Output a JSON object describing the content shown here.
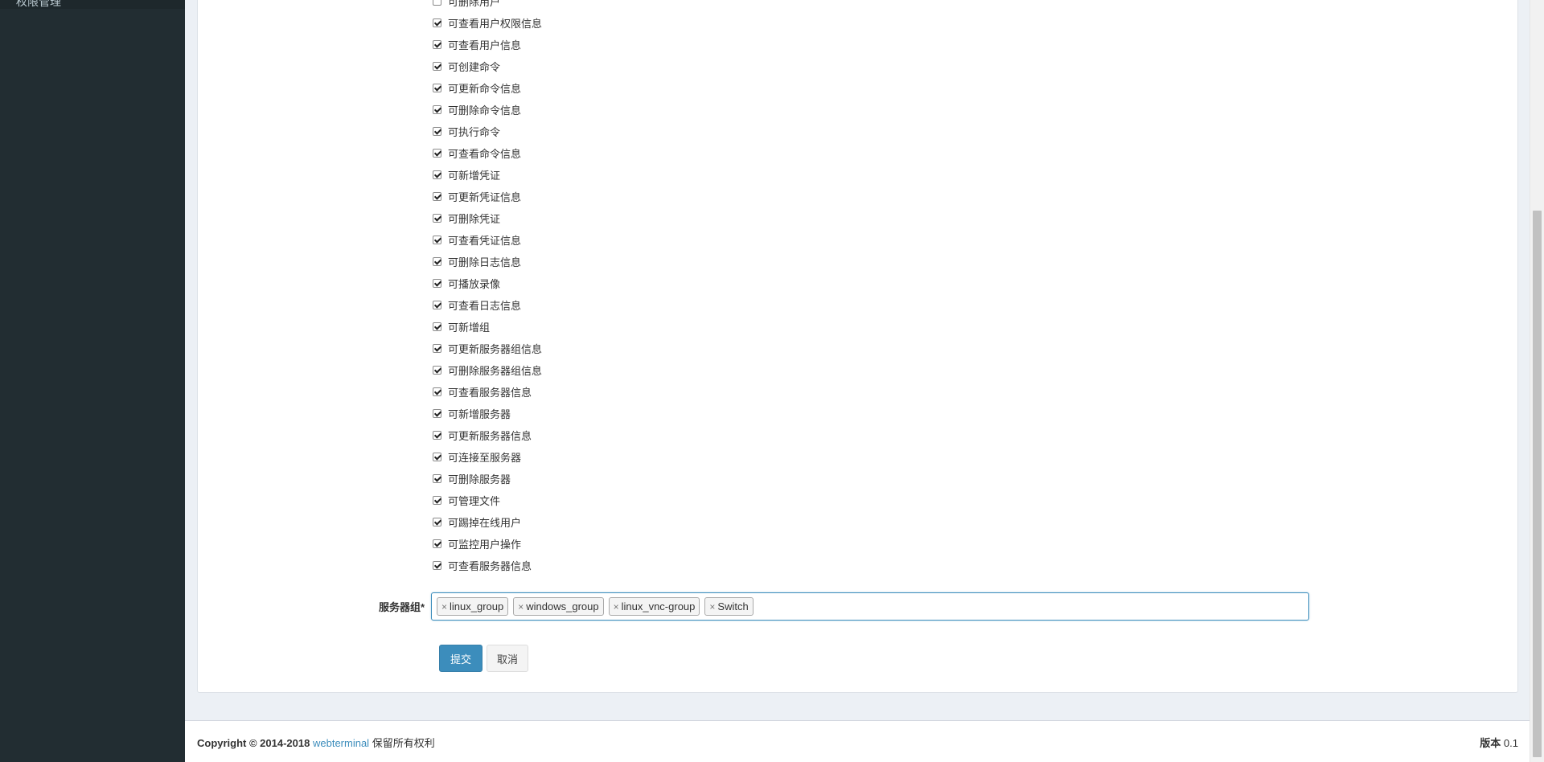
{
  "sidebar": {
    "partial_item": "权限管理"
  },
  "permissions": [
    {
      "label": "可删除用户",
      "checked": false,
      "partial": true
    },
    {
      "label": "可查看用户权限信息",
      "checked": true
    },
    {
      "label": "可查看用户信息",
      "checked": true
    },
    {
      "label": "可创建命令",
      "checked": true
    },
    {
      "label": "可更新命令信息",
      "checked": true
    },
    {
      "label": "可删除命令信息",
      "checked": true
    },
    {
      "label": "可执行命令",
      "checked": true
    },
    {
      "label": "可查看命令信息",
      "checked": true
    },
    {
      "label": "可新增凭证",
      "checked": true
    },
    {
      "label": "可更新凭证信息",
      "checked": true
    },
    {
      "label": "可删除凭证",
      "checked": true
    },
    {
      "label": "可查看凭证信息",
      "checked": true
    },
    {
      "label": "可删除日志信息",
      "checked": true
    },
    {
      "label": "可播放录像",
      "checked": true
    },
    {
      "label": "可查看日志信息",
      "checked": true
    },
    {
      "label": "可新增组",
      "checked": true
    },
    {
      "label": "可更新服务器组信息",
      "checked": true
    },
    {
      "label": "可删除服务器组信息",
      "checked": true
    },
    {
      "label": "可查看服务器信息",
      "checked": true
    },
    {
      "label": "可新增服务器",
      "checked": true
    },
    {
      "label": "可更新服务器信息",
      "checked": true
    },
    {
      "label": "可连接至服务器",
      "checked": true
    },
    {
      "label": "可删除服务器",
      "checked": true
    },
    {
      "label": "可管理文件",
      "checked": true
    },
    {
      "label": "可踢掉在线用户",
      "checked": true
    },
    {
      "label": "可监控用户操作",
      "checked": true
    },
    {
      "label": "可查看服务器信息",
      "checked": true
    }
  ],
  "server_group": {
    "label": "服务器组*",
    "tags": [
      "linux_group",
      "windows_group",
      "linux_vnc-group",
      "Switch"
    ],
    "remove_glyph": "×"
  },
  "buttons": {
    "submit": "提交",
    "cancel": "取消"
  },
  "footer": {
    "copyright": "Copyright © 2014-2018",
    "brand": "webterminal",
    "rights": "保留所有权利",
    "version_label": "版本",
    "version": "0.1"
  },
  "colors": {
    "sidebar_bg": "#222d32",
    "primary": "#3c8dbc",
    "content_bg": "#ecf0f5"
  }
}
